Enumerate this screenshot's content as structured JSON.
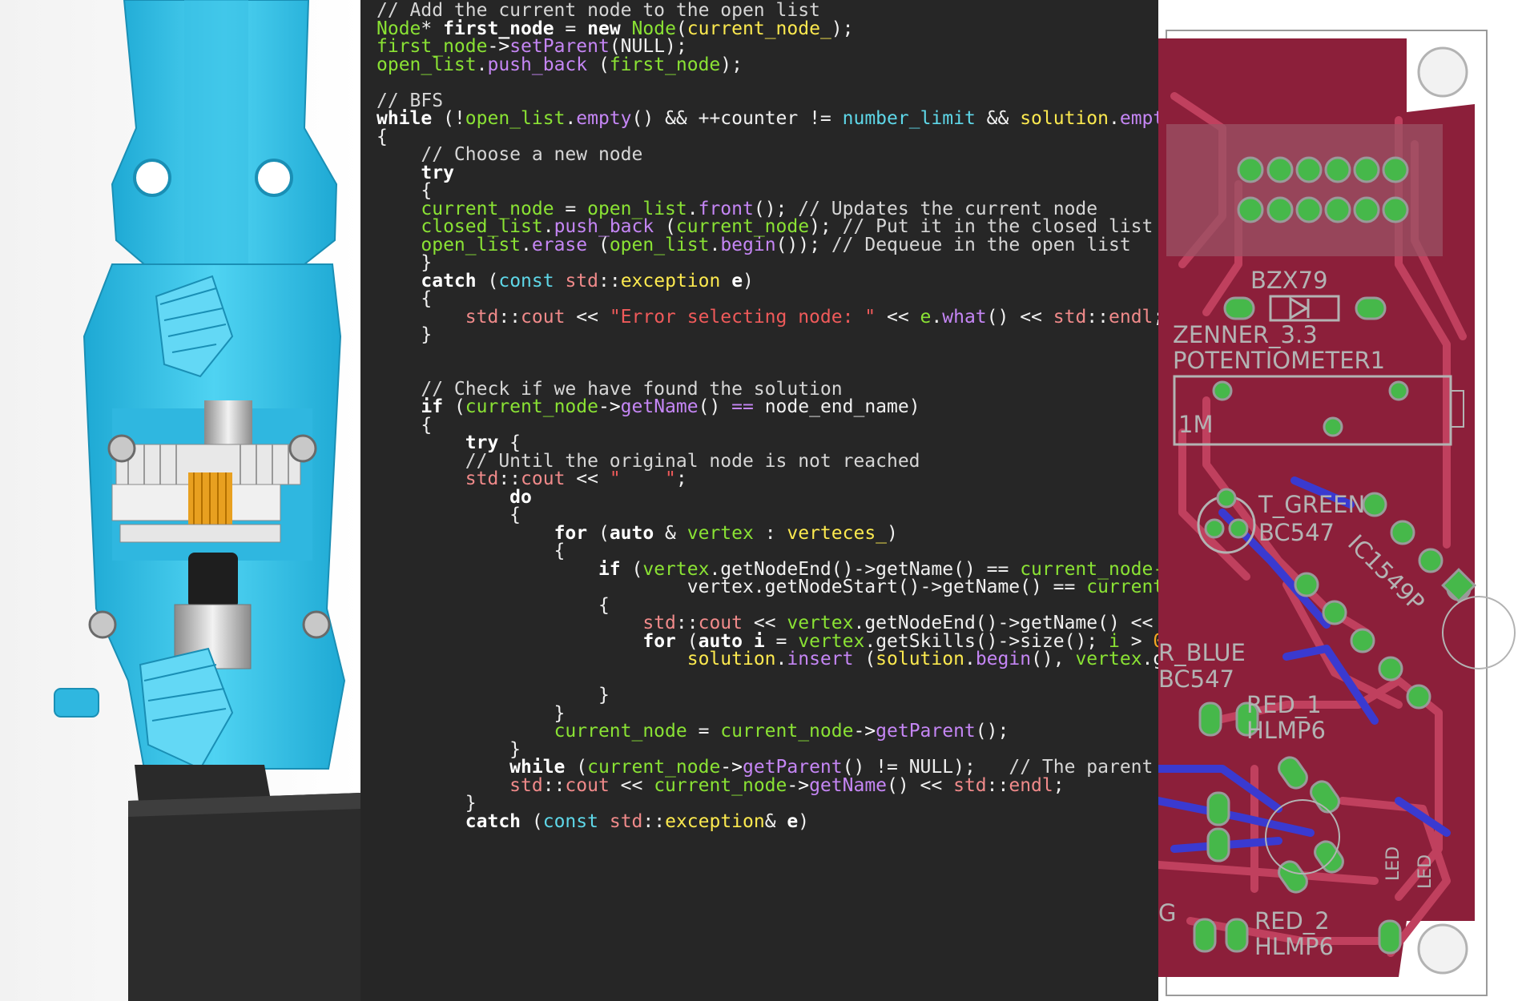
{
  "colors": {
    "editor_background": "#262626",
    "robot_body": "#3cc3ea",
    "pcb_board": "#8c1f3a",
    "pcb_trace": "#c0405e",
    "pcb_blue_trace": "#3a3ad0",
    "pcb_pad": "#46b84a",
    "pcb_silkscreen": "#b3b3b3"
  },
  "pcb_labels": [
    "BZX79",
    "ZENNER_3.3",
    "POTENTIOMETER1",
    "1M",
    "T_GREEN",
    "BC547",
    "IC1549P",
    "R_BLUE",
    "BC547",
    "RED_1",
    "HLMP6",
    "RED_2",
    "HLMP6",
    "G",
    "LED",
    "LED"
  ],
  "code_lines": [
    [
      [
        "// Add the current node to the open list",
        "comment"
      ]
    ],
    [
      [
        "Node",
        "type"
      ],
      [
        "* ",
        "plain"
      ],
      [
        "first_node",
        "bvar"
      ],
      [
        " = ",
        "plain"
      ],
      [
        "new",
        "keyword"
      ],
      [
        " ",
        "plain"
      ],
      [
        "Node",
        "type"
      ],
      [
        "(",
        "plain"
      ],
      [
        "current_node_",
        "member"
      ],
      [
        ");",
        "plain"
      ]
    ],
    [
      [
        "first_node",
        "var"
      ],
      [
        "->",
        "op"
      ],
      [
        "setParent",
        "func"
      ],
      [
        "(NULL);",
        "plain"
      ]
    ],
    [
      [
        "open_list",
        "var"
      ],
      [
        ".",
        "plain"
      ],
      [
        "push_back",
        "func"
      ],
      [
        " (",
        "plain"
      ],
      [
        "first_node",
        "var"
      ],
      [
        ");",
        "plain"
      ]
    ],
    [],
    [
      [
        "// BFS",
        "comment"
      ]
    ],
    [
      [
        "while",
        "keyword"
      ],
      [
        " (!",
        "plain"
      ],
      [
        "open_list",
        "var"
      ],
      [
        ".",
        "plain"
      ],
      [
        "empty",
        "func"
      ],
      [
        "() && ++counter != ",
        "plain"
      ],
      [
        "number_limit",
        "teal"
      ],
      [
        " && ",
        "plain"
      ],
      [
        "solution",
        "member"
      ],
      [
        ".",
        "plain"
      ],
      [
        "empt",
        "func"
      ]
    ],
    [
      [
        "{",
        "plain"
      ]
    ],
    [
      [
        "    ",
        "plain"
      ],
      [
        "// Choose a new node",
        "comment"
      ]
    ],
    [
      [
        "    ",
        "plain"
      ],
      [
        "try",
        "keyword"
      ]
    ],
    [
      [
        "    {",
        "plain"
      ]
    ],
    [
      [
        "    ",
        "plain"
      ],
      [
        "current_node",
        "var"
      ],
      [
        " = ",
        "plain"
      ],
      [
        "open_list",
        "var"
      ],
      [
        ".",
        "plain"
      ],
      [
        "front",
        "func"
      ],
      [
        "(); ",
        "plain"
      ],
      [
        "// Updates the current node",
        "comment"
      ]
    ],
    [
      [
        "    ",
        "plain"
      ],
      [
        "closed_list",
        "var"
      ],
      [
        ".",
        "plain"
      ],
      [
        "push_back",
        "func"
      ],
      [
        " (",
        "plain"
      ],
      [
        "current_node",
        "var"
      ],
      [
        "); ",
        "plain"
      ],
      [
        "// Put it in the closed list",
        "comment"
      ]
    ],
    [
      [
        "    ",
        "plain"
      ],
      [
        "open_list",
        "var"
      ],
      [
        ".",
        "plain"
      ],
      [
        "erase",
        "func"
      ],
      [
        " (",
        "plain"
      ],
      [
        "open_list",
        "var"
      ],
      [
        ".",
        "plain"
      ],
      [
        "begin",
        "func"
      ],
      [
        "()); ",
        "plain"
      ],
      [
        "// Dequeue in the open list",
        "comment"
      ]
    ],
    [
      [
        "    }",
        "plain"
      ]
    ],
    [
      [
        "    ",
        "plain"
      ],
      [
        "catch",
        "keyword"
      ],
      [
        " (",
        "plain"
      ],
      [
        "const",
        "teal"
      ],
      [
        " ",
        "plain"
      ],
      [
        "std",
        "ns"
      ],
      [
        "::",
        "plain"
      ],
      [
        "exception",
        "member"
      ],
      [
        " ",
        "plain"
      ],
      [
        "e",
        "bvar"
      ],
      [
        ")",
        "plain"
      ]
    ],
    [
      [
        "    {",
        "plain"
      ]
    ],
    [
      [
        "        ",
        "plain"
      ],
      [
        "std",
        "ns"
      ],
      [
        "::",
        "plain"
      ],
      [
        "cout",
        "ns"
      ],
      [
        " << ",
        "plain"
      ],
      [
        "\"Error selecting node: \"",
        "str"
      ],
      [
        " << ",
        "plain"
      ],
      [
        "e",
        "var"
      ],
      [
        ".",
        "plain"
      ],
      [
        "what",
        "func"
      ],
      [
        "() << ",
        "plain"
      ],
      [
        "std",
        "ns"
      ],
      [
        "::",
        "plain"
      ],
      [
        "endl",
        "ns"
      ],
      [
        ";",
        "plain"
      ]
    ],
    [
      [
        "    }",
        "plain"
      ]
    ],
    [],
    [],
    [
      [
        "    ",
        "plain"
      ],
      [
        "// Check if we have found the solution",
        "comment"
      ]
    ],
    [
      [
        "    ",
        "plain"
      ],
      [
        "if",
        "keyword"
      ],
      [
        " (",
        "plain"
      ],
      [
        "current_node",
        "var"
      ],
      [
        "->",
        "op"
      ],
      [
        "getName",
        "func"
      ],
      [
        "() ",
        "plain"
      ],
      [
        "==",
        "func"
      ],
      [
        " node_end_name)",
        "plain"
      ]
    ],
    [
      [
        "    {",
        "plain"
      ]
    ],
    [
      [
        "        ",
        "plain"
      ],
      [
        "try",
        "keyword"
      ],
      [
        " {",
        "plain"
      ]
    ],
    [
      [
        "        ",
        "plain"
      ],
      [
        "// Until the original node is not reached",
        "comment"
      ]
    ],
    [
      [
        "        ",
        "plain"
      ],
      [
        "std",
        "ns"
      ],
      [
        "::",
        "plain"
      ],
      [
        "cout",
        "ns"
      ],
      [
        " << ",
        "plain"
      ],
      [
        "\"    \"",
        "str"
      ],
      [
        ";",
        "plain"
      ]
    ],
    [
      [
        "            ",
        "plain"
      ],
      [
        "do",
        "keyword"
      ]
    ],
    [
      [
        "            {",
        "plain"
      ]
    ],
    [
      [
        "                ",
        "plain"
      ],
      [
        "for",
        "keyword"
      ],
      [
        " (",
        "plain"
      ],
      [
        "auto",
        "keyword"
      ],
      [
        " & ",
        "plain"
      ],
      [
        "vertex",
        "type"
      ],
      [
        " : ",
        "plain"
      ],
      [
        "verteces_",
        "member"
      ],
      [
        ")",
        "plain"
      ]
    ],
    [
      [
        "                {",
        "plain"
      ]
    ],
    [
      [
        "                    ",
        "plain"
      ],
      [
        "if",
        "keyword"
      ],
      [
        " (",
        "plain"
      ],
      [
        "vertex",
        "var"
      ],
      [
        ".getNodeEnd()->getName() == ",
        "plain"
      ],
      [
        "current_node-",
        "var"
      ]
    ],
    [
      [
        "                            vertex.getNodeStart()->getName() == ",
        "plain"
      ],
      [
        "current",
        "var"
      ]
    ],
    [
      [
        "                    {",
        "plain"
      ]
    ],
    [
      [
        "                        ",
        "plain"
      ],
      [
        "std",
        "ns"
      ],
      [
        "::",
        "plain"
      ],
      [
        "cout",
        "ns"
      ],
      [
        " << ",
        "plain"
      ],
      [
        "vertex",
        "var"
      ],
      [
        ".getNodeEnd()->getName() <<",
        "plain"
      ]
    ],
    [
      [
        "                        ",
        "plain"
      ],
      [
        "for",
        "keyword"
      ],
      [
        " (",
        "plain"
      ],
      [
        "auto",
        "keyword"
      ],
      [
        " ",
        "plain"
      ],
      [
        "i",
        "bvar"
      ],
      [
        " = ",
        "plain"
      ],
      [
        "vertex",
        "var"
      ],
      [
        ".getSkills()->size(); ",
        "plain"
      ],
      [
        "i",
        "var"
      ],
      [
        " > ",
        "plain"
      ],
      [
        "0",
        "num"
      ]
    ],
    [
      [
        "                            ",
        "plain"
      ],
      [
        "solution",
        "member"
      ],
      [
        ".",
        "plain"
      ],
      [
        "insert",
        "func"
      ],
      [
        " (",
        "plain"
      ],
      [
        "solution",
        "member"
      ],
      [
        ".",
        "plain"
      ],
      [
        "begin",
        "func"
      ],
      [
        "(), ",
        "plain"
      ],
      [
        "vertex",
        "var"
      ],
      [
        ".g",
        "plain"
      ]
    ],
    [],
    [
      [
        "                    }",
        "plain"
      ]
    ],
    [
      [
        "                }",
        "plain"
      ]
    ],
    [
      [
        "                ",
        "plain"
      ],
      [
        "current_node",
        "var"
      ],
      [
        " = ",
        "plain"
      ],
      [
        "current_node",
        "var"
      ],
      [
        "->",
        "op"
      ],
      [
        "getParent",
        "func"
      ],
      [
        "();",
        "plain"
      ]
    ],
    [
      [
        "            }",
        "plain"
      ]
    ],
    [
      [
        "            ",
        "plain"
      ],
      [
        "while",
        "keyword"
      ],
      [
        " (",
        "plain"
      ],
      [
        "current_node",
        "var"
      ],
      [
        "->",
        "op"
      ],
      [
        "getParent",
        "func"
      ],
      [
        "() != NULL);   ",
        "plain"
      ],
      [
        "// The parent",
        "comment"
      ]
    ],
    [
      [
        "            ",
        "plain"
      ],
      [
        "std",
        "ns"
      ],
      [
        "::",
        "plain"
      ],
      [
        "cout",
        "ns"
      ],
      [
        " << ",
        "plain"
      ],
      [
        "current_node",
        "var"
      ],
      [
        "->",
        "op"
      ],
      [
        "getName",
        "func"
      ],
      [
        "() << ",
        "plain"
      ],
      [
        "std",
        "ns"
      ],
      [
        "::",
        "plain"
      ],
      [
        "endl",
        "ns"
      ],
      [
        ";",
        "plain"
      ]
    ],
    [
      [
        "        }",
        "plain"
      ]
    ],
    [
      [
        "        ",
        "plain"
      ],
      [
        "catch",
        "keyword"
      ],
      [
        " (",
        "plain"
      ],
      [
        "const",
        "teal"
      ],
      [
        " ",
        "plain"
      ],
      [
        "std",
        "ns"
      ],
      [
        "::",
        "plain"
      ],
      [
        "exception",
        "member"
      ],
      [
        "& ",
        "plain"
      ],
      [
        "e",
        "bvar"
      ],
      [
        ")",
        "plain"
      ]
    ]
  ]
}
